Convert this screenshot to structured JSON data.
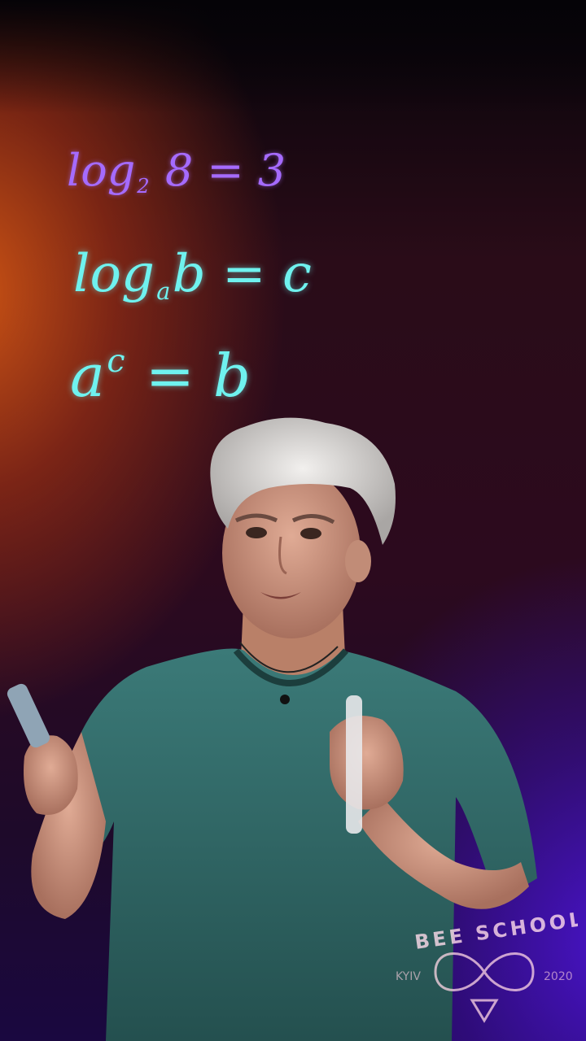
{
  "board": {
    "line1": {
      "base": "log",
      "sub": "2",
      "rest": "8 = 3"
    },
    "line2": {
      "base": "log",
      "sub": "a",
      "rest": "b = c"
    },
    "line3": {
      "base": "a",
      "sup": "c",
      "rest": "= b"
    }
  },
  "watermark": {
    "text": "BEE SCHOOL",
    "left_text": "KYIV",
    "right_text": "2020",
    "icon": "infinity-bee-icon"
  },
  "colors": {
    "line1": "#a56bff",
    "line2": "#6ff2ef",
    "line3": "#6ff2ef",
    "shirt": "#2e6a68",
    "hair": "#d8d6d4"
  }
}
